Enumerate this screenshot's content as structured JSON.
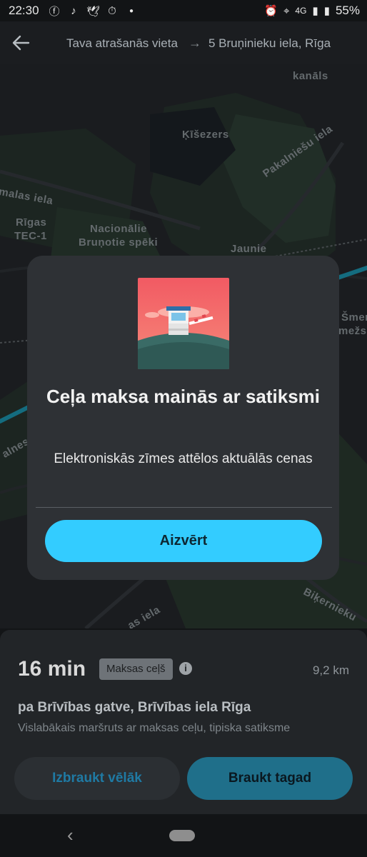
{
  "status_bar": {
    "time": "22:30",
    "left_icons": [
      "facebook-icon",
      "tiktok-icon",
      "twitter-icon",
      "timer-icon",
      "dot-icon"
    ],
    "network": "4G",
    "battery": "55%"
  },
  "header": {
    "from": "Tava atrašanās vieta",
    "arrow": "→",
    "to": "5 Bruņinieku iela, Rīga"
  },
  "map": {
    "labels": [
      "kanāls",
      "Ķīšezers",
      "Pakalniešu iela",
      "malas iela",
      "Rīgas",
      "TEC-1",
      "Nacionālie",
      "Bruņotie spēki",
      "Jaunie",
      "Šmerl",
      "mežs",
      "alnes i",
      "Biķernieku",
      "as iela"
    ]
  },
  "modal": {
    "title": "Ceļa maksa mainās ar satiksmi",
    "description": "Elektroniskās zīmes attēlos aktuālās cenas",
    "close_label": "Aizvērt"
  },
  "sheet": {
    "eta": "16 min",
    "toll_badge": "Maksas ceļš",
    "info_symbol": "i",
    "distance": "9,2 km",
    "route_name": "pa Brīvības gatve, Brīvības iela Rīga",
    "route_description": "Vislabākais maršruts ar maksas ceļu, tipiska satiksme",
    "later_label": "Izbraukt vēlāk",
    "go_label": "Braukt tagad"
  },
  "navbar": {
    "back_symbol": "‹"
  },
  "colors": {
    "accent": "#33ccff",
    "modal_bg": "#2e3135",
    "route_line": "#1fa7c4"
  }
}
